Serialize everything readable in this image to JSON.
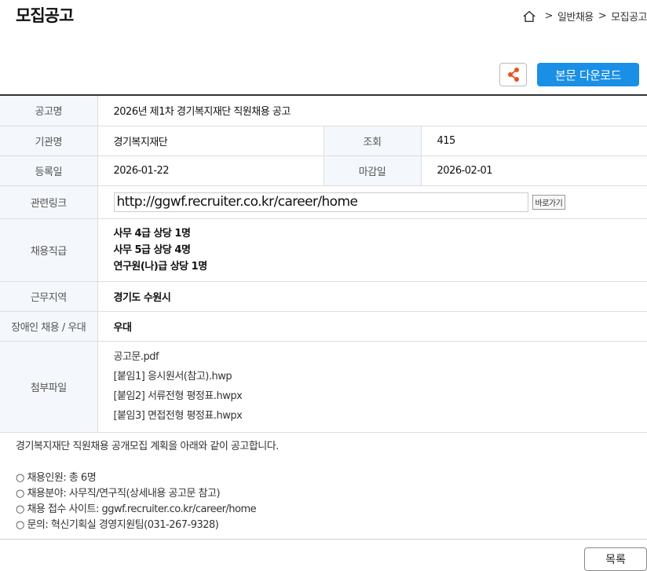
{
  "page_title": "모집공고",
  "breadcrumb": {
    "items": [
      "일반채용",
      "모집공고"
    ],
    "sep": ">"
  },
  "toolbar": {
    "download_label": "본문 다운로드"
  },
  "info": {
    "title_label": "공고명",
    "title_value": "2026년 제1차 경기복지재단 직원채용 공고",
    "org_label": "기관명",
    "org_value": "경기복지재단",
    "views_label": "조회",
    "views_value": "415",
    "reg_label": "등록일",
    "reg_value": "2026-01-22",
    "deadline_label": "마감일",
    "deadline_value": "2026-02-01",
    "link_label": "관련링크",
    "link_value": "http://ggwf.recruiter.co.kr/career/home",
    "go_label": "바로가기",
    "positions_label": "채용직급",
    "positions": [
      "사무 4급 상당 1명",
      "사무 5급 상당 4명",
      "연구원(나)급 상당 1명"
    ],
    "region_label": "근무지역",
    "region_value": "경기도 수원시",
    "disability_label": "장애인 채용 / 우대",
    "disability_value": "우대",
    "files_label": "첨부파일",
    "files": [
      "공고문.pdf",
      "[붙임1] 응시원서(참고).hwp",
      "[붙임2] 서류전형 평정표.hwpx",
      "[붙임3] 면접전형 평정표.hwpx"
    ]
  },
  "notice": {
    "intro": "경기복지재단 직원채용 공개모집 계획을 아래와 같이 공고합니다.",
    "items": [
      "○ 채용인원: 총 6명",
      "○ 채용분야: 사무직/연구직(상세내용 공고문 참고)",
      "○ 채용 접수 사이트: ggwf.recruiter.co.kr/career/home",
      "○ 문의: 혁신기획실 경영지원팀(031-267-9328)"
    ]
  },
  "list_button": "목록",
  "colors": {
    "accent": "#1a8fe6",
    "share_icon": "#e8531f",
    "header_bg": "#f4f7fb"
  },
  "icons": {
    "home": "home-icon",
    "share": "share-icon"
  }
}
